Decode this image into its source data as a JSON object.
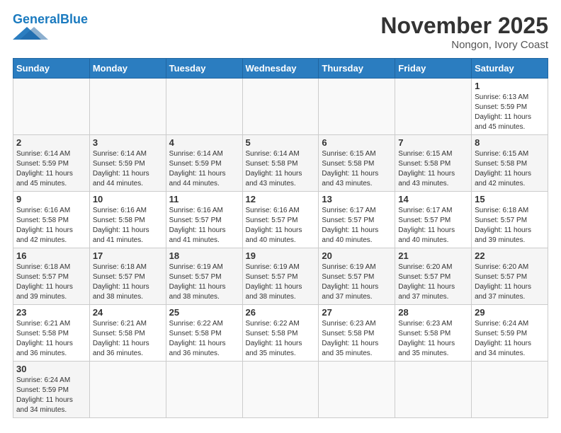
{
  "header": {
    "logo_general": "General",
    "logo_blue": "Blue",
    "month_title": "November 2025",
    "location": "Nongon, Ivory Coast"
  },
  "weekdays": [
    "Sunday",
    "Monday",
    "Tuesday",
    "Wednesday",
    "Thursday",
    "Friday",
    "Saturday"
  ],
  "weeks": [
    [
      {
        "day": "",
        "info": ""
      },
      {
        "day": "",
        "info": ""
      },
      {
        "day": "",
        "info": ""
      },
      {
        "day": "",
        "info": ""
      },
      {
        "day": "",
        "info": ""
      },
      {
        "day": "",
        "info": ""
      },
      {
        "day": "1",
        "info": "Sunrise: 6:13 AM\nSunset: 5:59 PM\nDaylight: 11 hours and 45 minutes."
      }
    ],
    [
      {
        "day": "2",
        "info": "Sunrise: 6:14 AM\nSunset: 5:59 PM\nDaylight: 11 hours and 45 minutes."
      },
      {
        "day": "3",
        "info": "Sunrise: 6:14 AM\nSunset: 5:59 PM\nDaylight: 11 hours and 44 minutes."
      },
      {
        "day": "4",
        "info": "Sunrise: 6:14 AM\nSunset: 5:59 PM\nDaylight: 11 hours and 44 minutes."
      },
      {
        "day": "5",
        "info": "Sunrise: 6:14 AM\nSunset: 5:58 PM\nDaylight: 11 hours and 43 minutes."
      },
      {
        "day": "6",
        "info": "Sunrise: 6:15 AM\nSunset: 5:58 PM\nDaylight: 11 hours and 43 minutes."
      },
      {
        "day": "7",
        "info": "Sunrise: 6:15 AM\nSunset: 5:58 PM\nDaylight: 11 hours and 43 minutes."
      },
      {
        "day": "8",
        "info": "Sunrise: 6:15 AM\nSunset: 5:58 PM\nDaylight: 11 hours and 42 minutes."
      }
    ],
    [
      {
        "day": "9",
        "info": "Sunrise: 6:16 AM\nSunset: 5:58 PM\nDaylight: 11 hours and 42 minutes."
      },
      {
        "day": "10",
        "info": "Sunrise: 6:16 AM\nSunset: 5:58 PM\nDaylight: 11 hours and 41 minutes."
      },
      {
        "day": "11",
        "info": "Sunrise: 6:16 AM\nSunset: 5:57 PM\nDaylight: 11 hours and 41 minutes."
      },
      {
        "day": "12",
        "info": "Sunrise: 6:16 AM\nSunset: 5:57 PM\nDaylight: 11 hours and 40 minutes."
      },
      {
        "day": "13",
        "info": "Sunrise: 6:17 AM\nSunset: 5:57 PM\nDaylight: 11 hours and 40 minutes."
      },
      {
        "day": "14",
        "info": "Sunrise: 6:17 AM\nSunset: 5:57 PM\nDaylight: 11 hours and 40 minutes."
      },
      {
        "day": "15",
        "info": "Sunrise: 6:18 AM\nSunset: 5:57 PM\nDaylight: 11 hours and 39 minutes."
      }
    ],
    [
      {
        "day": "16",
        "info": "Sunrise: 6:18 AM\nSunset: 5:57 PM\nDaylight: 11 hours and 39 minutes."
      },
      {
        "day": "17",
        "info": "Sunrise: 6:18 AM\nSunset: 5:57 PM\nDaylight: 11 hours and 38 minutes."
      },
      {
        "day": "18",
        "info": "Sunrise: 6:19 AM\nSunset: 5:57 PM\nDaylight: 11 hours and 38 minutes."
      },
      {
        "day": "19",
        "info": "Sunrise: 6:19 AM\nSunset: 5:57 PM\nDaylight: 11 hours and 38 minutes."
      },
      {
        "day": "20",
        "info": "Sunrise: 6:19 AM\nSunset: 5:57 PM\nDaylight: 11 hours and 37 minutes."
      },
      {
        "day": "21",
        "info": "Sunrise: 6:20 AM\nSunset: 5:57 PM\nDaylight: 11 hours and 37 minutes."
      },
      {
        "day": "22",
        "info": "Sunrise: 6:20 AM\nSunset: 5:57 PM\nDaylight: 11 hours and 37 minutes."
      }
    ],
    [
      {
        "day": "23",
        "info": "Sunrise: 6:21 AM\nSunset: 5:58 PM\nDaylight: 11 hours and 36 minutes."
      },
      {
        "day": "24",
        "info": "Sunrise: 6:21 AM\nSunset: 5:58 PM\nDaylight: 11 hours and 36 minutes."
      },
      {
        "day": "25",
        "info": "Sunrise: 6:22 AM\nSunset: 5:58 PM\nDaylight: 11 hours and 36 minutes."
      },
      {
        "day": "26",
        "info": "Sunrise: 6:22 AM\nSunset: 5:58 PM\nDaylight: 11 hours and 35 minutes."
      },
      {
        "day": "27",
        "info": "Sunrise: 6:23 AM\nSunset: 5:58 PM\nDaylight: 11 hours and 35 minutes."
      },
      {
        "day": "28",
        "info": "Sunrise: 6:23 AM\nSunset: 5:58 PM\nDaylight: 11 hours and 35 minutes."
      },
      {
        "day": "29",
        "info": "Sunrise: 6:24 AM\nSunset: 5:59 PM\nDaylight: 11 hours and 34 minutes."
      }
    ],
    [
      {
        "day": "30",
        "info": "Sunrise: 6:24 AM\nSunset: 5:59 PM\nDaylight: 11 hours and 34 minutes."
      },
      {
        "day": "",
        "info": ""
      },
      {
        "day": "",
        "info": ""
      },
      {
        "day": "",
        "info": ""
      },
      {
        "day": "",
        "info": ""
      },
      {
        "day": "",
        "info": ""
      },
      {
        "day": "",
        "info": ""
      }
    ]
  ]
}
